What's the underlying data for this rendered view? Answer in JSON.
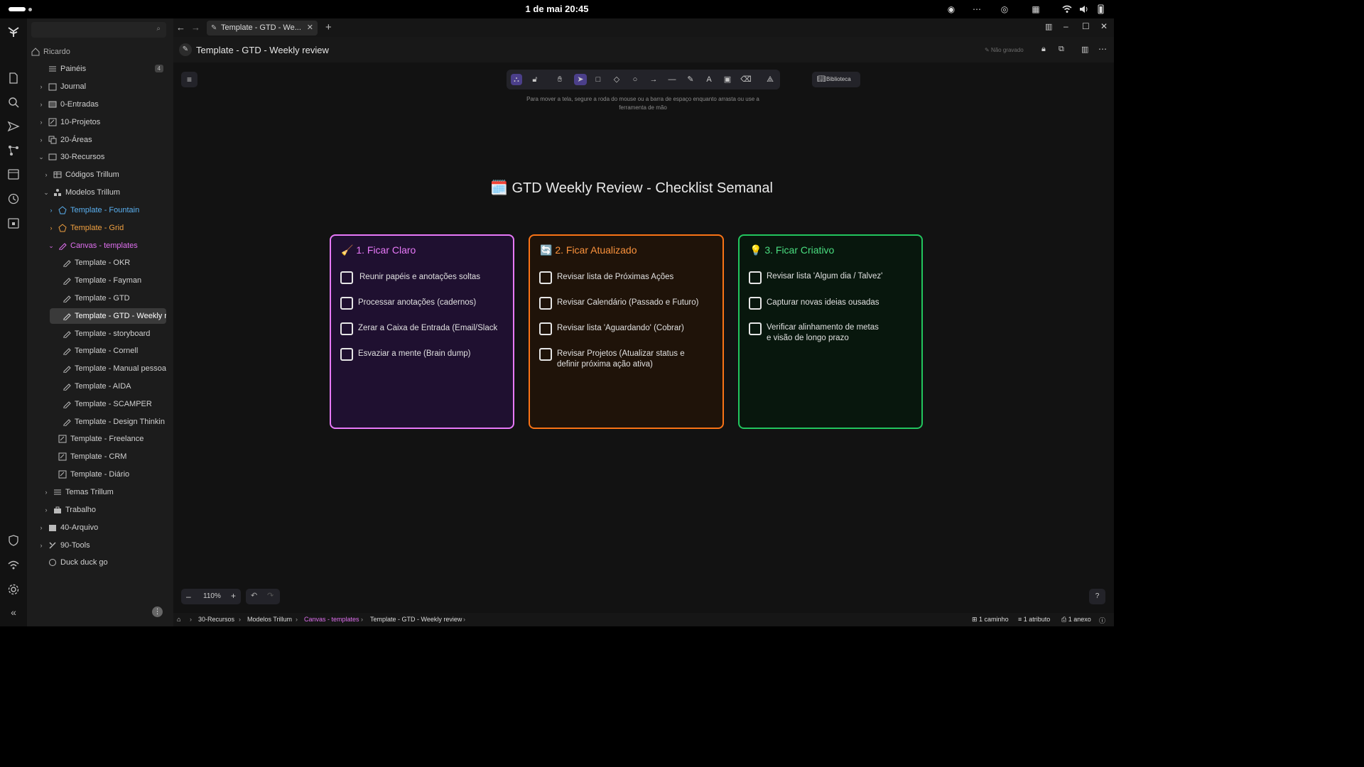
{
  "system": {
    "clock": "1 de mai  20:45"
  },
  "sidebar": {
    "root": "Ricardo",
    "badge": "4",
    "items": [
      {
        "label": "Painéis"
      },
      {
        "label": "Journal"
      },
      {
        "label": "0-Entradas"
      },
      {
        "label": "10-Projetos"
      },
      {
        "label": "20-Áreas"
      },
      {
        "label": "30-Recursos"
      },
      {
        "label": "Códigos Trillum"
      },
      {
        "label": "Modelos Trillum"
      },
      {
        "label": "Template - Fountain"
      },
      {
        "label": "Template - Grid"
      },
      {
        "label": "Canvas - templates"
      },
      {
        "label": "Template - OKR"
      },
      {
        "label": "Template - Fayman"
      },
      {
        "label": "Template - GTD"
      },
      {
        "label": "Template - GTD - Weekly r"
      },
      {
        "label": "Template - storyboard"
      },
      {
        "label": "Template - Cornell"
      },
      {
        "label": "Template - Manual pessoa"
      },
      {
        "label": "Template - AIDA"
      },
      {
        "label": "Template - SCAMPER"
      },
      {
        "label": "Template - Design Thinkin"
      },
      {
        "label": "Template - Freelance"
      },
      {
        "label": "Template - CRM"
      },
      {
        "label": "Template - Diário"
      },
      {
        "label": "Temas Trillum"
      },
      {
        "label": "Trabalho"
      },
      {
        "label": "40-Arquivo"
      },
      {
        "label": "90-Tools"
      },
      {
        "label": "Duck duck go"
      }
    ]
  },
  "tabs": [
    {
      "label": "Template - GTD - We..."
    }
  ],
  "note": {
    "title": "Template - GTD - Weekly review",
    "save_status": "Não gravado"
  },
  "canvas": {
    "library": "Biblioteca",
    "hint": "Para mover a tela, segure a roda do mouse ou a barra de espaço enquanto arrasta ou use a ferramenta de mão",
    "title": "🗓️ GTD Weekly Review - Checklist Semanal",
    "zoom": "110%",
    "columns": [
      {
        "title": "🧹 1. Ficar Claro",
        "color": "#e879f9",
        "items": [
          "Reunir papéis e anotações soltas",
          "Processar anotações (cadernos)",
          "Zerar a Caixa de Entrada (Email/Slack",
          "Esvaziar a mente (Brain dump)"
        ]
      },
      {
        "title": "🔄 2. Ficar Atualizado",
        "color": "#f97316",
        "items": [
          "Revisar lista de Próximas Ações",
          "Revisar Calendário (Passado e Futuro)",
          "Revisar lista 'Aguardando' (Cobrar)",
          "Revisar Projetos (Atualizar status e definir próxima ação ativa)"
        ]
      },
      {
        "title": "💡 3. Ficar Criativo",
        "color": "#22c55e",
        "items": [
          "Revisar lista 'Algum dia / Talvez'",
          "Capturar novas ideias ousadas",
          "Verificar alinhamento de metas e visão de longo prazo"
        ]
      }
    ]
  },
  "breadcrumb": [
    "30-Recursos",
    "Modelos Trillum",
    "Canvas - templates",
    "Template - GTD - Weekly review"
  ],
  "status": {
    "paths": "1 caminho",
    "attributes": "1 atributo",
    "attachments": "1 anexo"
  }
}
